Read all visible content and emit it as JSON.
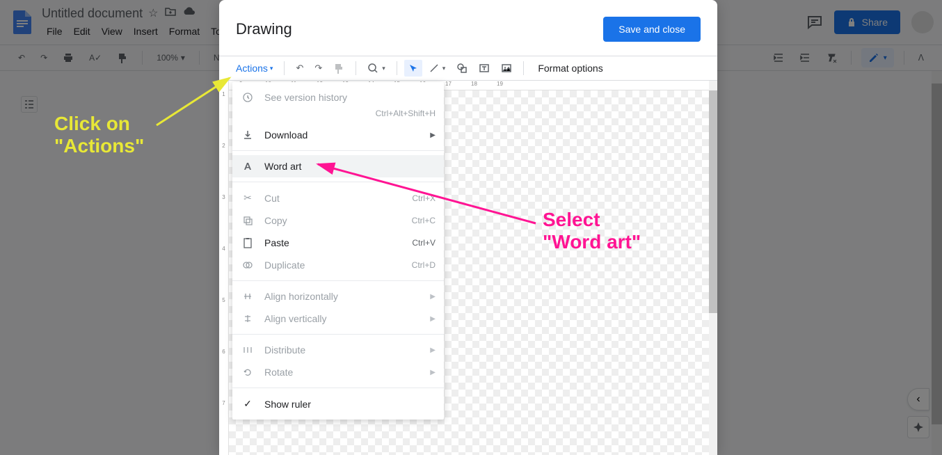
{
  "docs": {
    "title": "Untitled document",
    "menus": [
      "File",
      "Edit",
      "View",
      "Insert",
      "Format",
      "To"
    ],
    "share": "Share",
    "zoom": "100%",
    "style": "Normal text"
  },
  "dialog": {
    "title": "Drawing",
    "save": "Save and close",
    "actions_label": "Actions",
    "format_options": "Format options"
  },
  "ruler_h": [
    "9",
    "10",
    "11",
    "12",
    "13",
    "14",
    "15",
    "16",
    "17",
    "18",
    "19"
  ],
  "ruler_v": [
    "1",
    "2",
    "3",
    "4",
    "5",
    "6",
    "7"
  ],
  "menu": {
    "version": {
      "label": "See version history",
      "shortcut": "Ctrl+Alt+Shift+H"
    },
    "download": {
      "label": "Download"
    },
    "wordart": {
      "label": "Word art"
    },
    "cut": {
      "label": "Cut",
      "shortcut": "Ctrl+X"
    },
    "copy": {
      "label": "Copy",
      "shortcut": "Ctrl+C"
    },
    "paste": {
      "label": "Paste",
      "shortcut": "Ctrl+V"
    },
    "duplicate": {
      "label": "Duplicate",
      "shortcut": "Ctrl+D"
    },
    "alignh": {
      "label": "Align horizontally"
    },
    "alignv": {
      "label": "Align vertically"
    },
    "distribute": {
      "label": "Distribute"
    },
    "rotate": {
      "label": "Rotate"
    },
    "ruler": {
      "label": "Show ruler"
    }
  },
  "annotations": {
    "line1a": "Click on",
    "line1b": "\"Actions\"",
    "line2a": "Select",
    "line2b": "\"Word art\""
  }
}
